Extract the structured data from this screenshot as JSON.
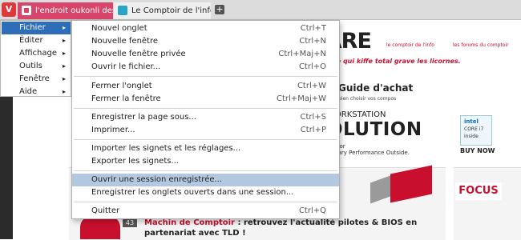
{
  "tabs": [
    {
      "title": "l'endroit oukonli des trucs"
    },
    {
      "title": "Le Comptoir de l'info"
    }
  ],
  "new_tab_symbol": "+",
  "vivaldi_symbol": "V",
  "sidebar_menu": {
    "items": [
      {
        "label": "Fichier"
      },
      {
        "label": "Éditer"
      },
      {
        "label": "Affichage"
      },
      {
        "label": "Outils"
      },
      {
        "label": "Fenêtre"
      },
      {
        "label": "Aide"
      }
    ],
    "arrow": "▸"
  },
  "file_menu": {
    "items": [
      {
        "label": "Nouvel onglet",
        "shortcut": "Ctrl+T"
      },
      {
        "label": "Nouvelle fenêtre",
        "shortcut": "Ctrl+N"
      },
      {
        "label": "Nouvelle fenêtre privée",
        "shortcut": "Ctrl+Maj+N"
      },
      {
        "label": "Ouvrir le fichier...",
        "shortcut": "Ctrl+O"
      },
      {
        "label": "Fermer l'onglet",
        "shortcut": "Ctrl+W"
      },
      {
        "label": "Fermer la fenêtre",
        "shortcut": "Ctrl+Maj+W"
      },
      {
        "label": "Enregistrer la page sous...",
        "shortcut": "Ctrl+S"
      },
      {
        "label": "Imprimer...",
        "shortcut": "Ctrl+P"
      },
      {
        "label": "Importer les signets et les réglages...",
        "shortcut": ""
      },
      {
        "label": "Exporter les signets...",
        "shortcut": ""
      },
      {
        "label": "Ouvrir une session enregistrée...",
        "shortcut": ""
      },
      {
        "label": "Enregistrer les onglets ouverts dans une session...",
        "shortcut": ""
      },
      {
        "label": "Quitter",
        "shortcut": "Ctrl+Q"
      }
    ]
  },
  "webpage": {
    "link_comptoir": "le comptoir de l'info",
    "link_forums": "les forums du comptoir",
    "brand": "RDWARE",
    "slogan": "ware qui kiffe total grave les licornes.",
    "guide_title": "Guide d'achat",
    "guide_sub": "bien choisir vos compos",
    "ad_line1": "WORKSTATION",
    "ad_line2": "OLUTION",
    "ad_line3a": "cessor",
    "ad_line3b": "rdinary Performance Outside.",
    "chip_brand": "intel",
    "chip_line1": "CORE i7",
    "chip_line2": "inside",
    "buy_now": "BUY NOW",
    "focus": "FOCUS",
    "badge": "43",
    "article_lead": "Machin de Comptoir",
    "article_rest": " : retrouvez l'actualité pilotes & BIOS en partenariat avec TLD !"
  },
  "colors": {
    "accent_red": "#c8102e",
    "active_tab": "#d8456a",
    "menu_highlight": "#b3c8e0",
    "sidebar_active": "#2e6db8"
  }
}
